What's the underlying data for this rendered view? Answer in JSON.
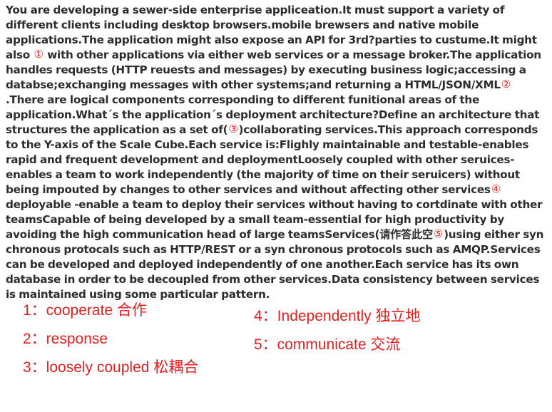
{
  "passage": {
    "seg1": "You are developing a sewer-side enterprise appliceation.It must support a variety of different clients including desktop browsers.mobile brewsers and native mobile applications.The application might also expose an API for 3rd?parties to custume.It might also ",
    "marker1": "①",
    "seg2": " with other applications via either web services or a message broker.The application handles requests (HTTP reuests and messages) by executing business logic;accessing a databse;exchanging messages with other systems;and returning a HTML/JSON/XML",
    "marker2": "②",
    "seg3": ".There are logical components corresponding to different funitional areas of the application.What´s the application´s deployment architecture?Define an architecture that structures the application as a set of(",
    "marker3": "③",
    "seg4": ")collaborating services.This approach corresponds to the Y-axis of the Scale Cube.Each service is:Flighly maintainable and testable-enables rapid and frequent development and deploymentLoosely coupled with other seruices-enables a team to work independently (the majority of time on their seruicers) without being impouted by changes to other services and without affecting other services",
    "marker4": "④",
    "seg5": "deployable -enable a team to deploy their services without having to cortdinate with other teamsCapable of being developed by a small team-essential for high productivity by avoiding the high communication head of large teamsServices(请作答此空",
    "marker5": "⑤",
    "seg6": ")using either syn chronous protocals such as HTTP/REST or a syn chronous protocols such as AMQP.Services can be developed and deployed independently of one another.Each service has its own database in order to be decoupled from other services.Data consistency between services is maintained using some particular pattern."
  },
  "answers": {
    "left": [
      "1：cooperate 合作",
      "2：response",
      "3：loosely coupled 松耦合"
    ],
    "right": [
      "4：Independently 独立地",
      "5：communicate  交流"
    ]
  }
}
